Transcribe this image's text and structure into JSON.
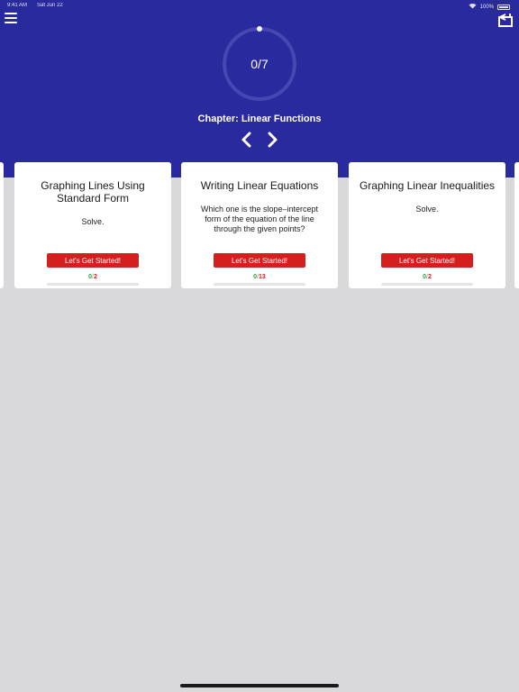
{
  "status_bar": {
    "time": "9:41 AM",
    "date": "Sat Jun 22",
    "battery": "100%"
  },
  "header": {
    "progress": {
      "label": "0/7",
      "completed": 0,
      "total": 7
    },
    "chapter_title": "Chapter: Linear Functions"
  },
  "lessons": [
    {
      "title": "Graphing Lines Using Standard Form",
      "description": "Solve.",
      "button": "Let's Get Started!",
      "done": "0",
      "sep": "/",
      "total": "2"
    },
    {
      "title": "Writing Linear Equations",
      "description": "Which one is the slope–intercept form of the equation of the line through the given points?",
      "button": "Let's Get Started!",
      "done": "0",
      "sep": "/",
      "total": "13"
    },
    {
      "title": "Graphing Linear Inequalities",
      "description": "Solve.",
      "button": "Let's Get Started!",
      "done": "0",
      "sep": "/",
      "total": "2"
    }
  ],
  "icons": {
    "menu": "hamburger-menu-icon",
    "exit": "exit-icon",
    "prev": "chevron-left-icon",
    "next": "chevron-right-icon"
  },
  "colors": {
    "header_bg": "#2a2a9f",
    "accent_red": "#d3201f",
    "done_green": "#2d9d3a",
    "background": "#d9d8da"
  }
}
